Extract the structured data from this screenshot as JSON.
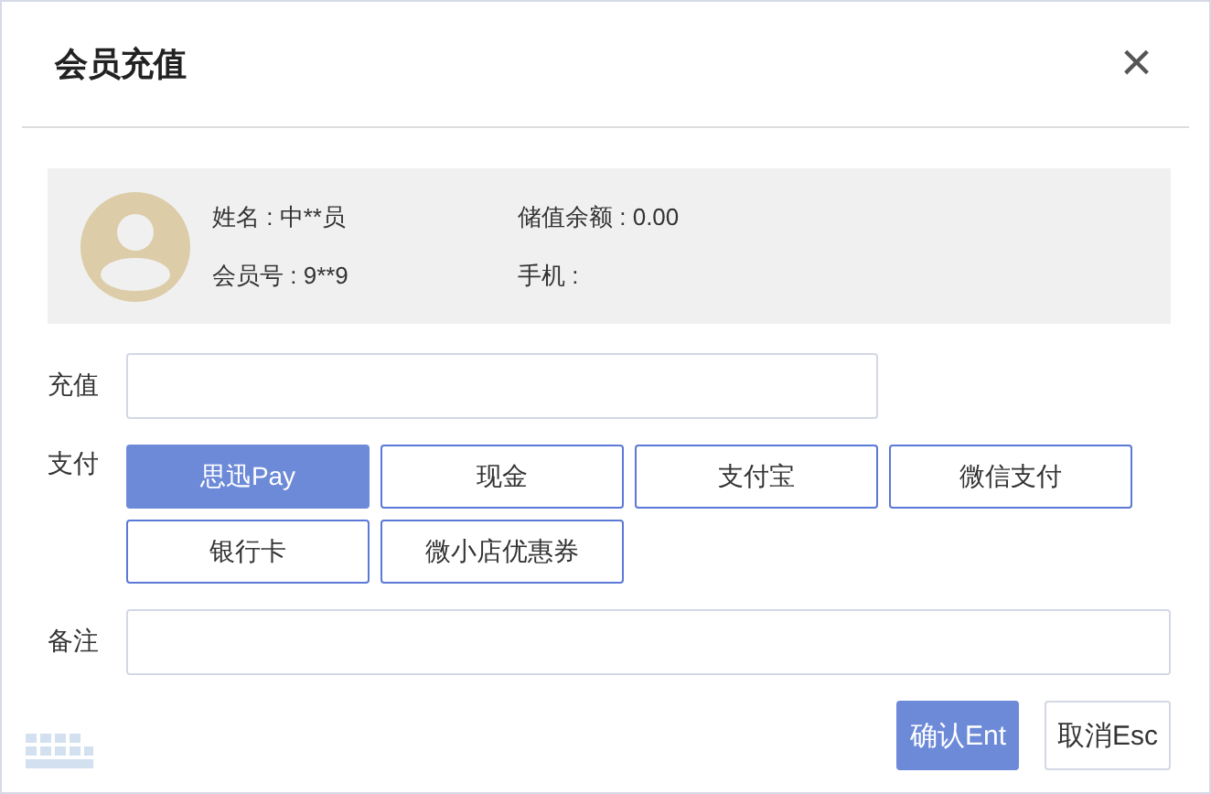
{
  "window": {
    "title": "会员充值",
    "close": "×"
  },
  "member": {
    "fields": [
      {
        "label": "姓名 : 中**员"
      },
      {
        "label": "储值余额 : 0.00"
      },
      {
        "label": "会员号 : 9**9"
      },
      {
        "label": "手机 :"
      }
    ]
  },
  "recharge": {
    "label": "充值"
  },
  "payment": {
    "label": "支付",
    "options": [
      {
        "label": "思迅Pay",
        "selected": true
      },
      {
        "label": "现金",
        "selected": false
      },
      {
        "label": "支付宝",
        "selected": false
      },
      {
        "label": "微信支付",
        "selected": false
      },
      {
        "label": "银行卡",
        "selected": false
      },
      {
        "label": "微小店优惠券",
        "selected": false
      }
    ]
  },
  "note": {
    "label": "备注"
  },
  "buttons": [
    {
      "label": "确认Ent",
      "kind": "primary"
    },
    {
      "label": "取消Esc",
      "kind": "secondary"
    }
  ]
}
